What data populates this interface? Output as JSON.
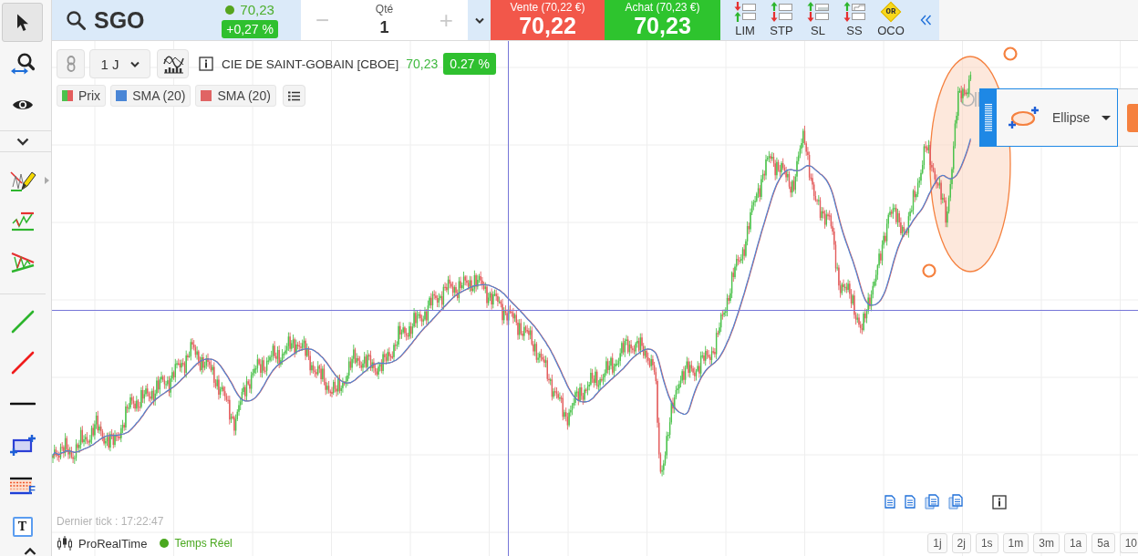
{
  "left_toolbar": {
    "top_tools": [
      {
        "kind": "pointer",
        "selected": true,
        "submenu": false
      },
      {
        "kind": "zoom",
        "selected": false,
        "submenu": false
      },
      {
        "kind": "visibility",
        "selected": false,
        "submenu": false
      }
    ],
    "draw_tools": [
      {
        "kind": "freehand",
        "selected": false,
        "submenu": true
      },
      {
        "kind": "channel",
        "selected": false,
        "submenu": false
      },
      {
        "kind": "triangle",
        "selected": false,
        "submenu": false
      }
    ],
    "line_tools": [
      {
        "kind": "line_up",
        "selected": false,
        "submenu": false
      },
      {
        "kind": "line_down",
        "selected": false,
        "submenu": false
      },
      {
        "kind": "horizontal",
        "selected": false,
        "submenu": false
      },
      {
        "kind": "rectangle",
        "selected": false,
        "submenu": false
      },
      {
        "kind": "fibonacci",
        "glyph": "F",
        "selected": false,
        "submenu": false
      },
      {
        "kind": "text",
        "glyph": "T",
        "selected": false,
        "submenu": false
      }
    ]
  },
  "quote": {
    "symbol": "SGO",
    "last": "70,23",
    "change": "+0,27 %"
  },
  "quantity": {
    "decrease": "−",
    "label": "Qté",
    "value": "1",
    "increase": "+"
  },
  "sell": {
    "label": "Vente (70,22 €)",
    "price": "70,22"
  },
  "buy": {
    "label": "Achat (70,23 €)",
    "price": "70,23"
  },
  "order_types": [
    {
      "kind": "lim",
      "label": "LIM"
    },
    {
      "kind": "stp",
      "label": "STP"
    },
    {
      "kind": "sl",
      "label": "SL"
    },
    {
      "kind": "ss",
      "label": "SS"
    },
    {
      "kind": "oco",
      "glyph": "OR",
      "label": "OCO"
    }
  ],
  "chart": {
    "interval": "1 J",
    "instrument": "CIE DE SAINT-GOBAIN [CBOE]",
    "price": "70,23",
    "change": "0.27 %",
    "legend": [
      {
        "kind": "price",
        "label": "Prix"
      },
      {
        "kind": "line",
        "label": "SMA (20)",
        "color": "#4a86d6"
      },
      {
        "kind": "line",
        "label": "SMA (20)",
        "color": "#e06464"
      }
    ],
    "crosshair": true,
    "drawing": {
      "kind": "ellipse",
      "selected": true
    },
    "drawing_toolbar": {
      "label": "Ellipse"
    },
    "last_tick": "Dernier tick : 17:22:47",
    "timeframes": [
      {
        "label": "1j",
        "selected": false
      },
      {
        "label": "2j",
        "selected": false
      },
      {
        "label": "1s",
        "selected": false
      },
      {
        "label": "1m",
        "selected": false
      },
      {
        "label": "3m",
        "selected": false
      },
      {
        "label": "1a",
        "selected": false
      },
      {
        "label": "5a",
        "selected": false
      },
      {
        "label": "10",
        "selected": false
      }
    ]
  },
  "footer": {
    "brand": "ProRealTime",
    "feed": "Temps Réel"
  }
}
